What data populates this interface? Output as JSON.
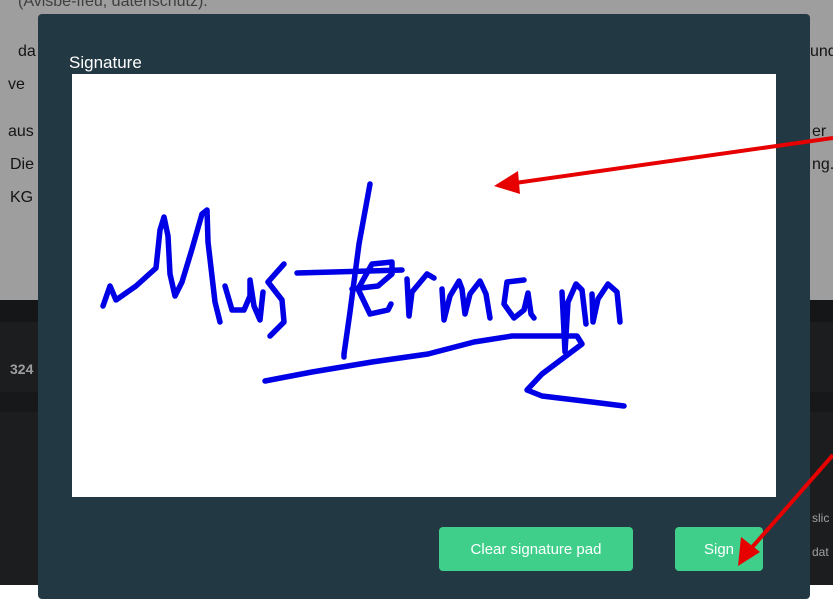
{
  "background": {
    "lines": [
      "(Avisbe-ffeu, datenschutz).",
      "da",
      "ve",
      "aus",
      "Die",
      "KG",
      "und",
      "er",
      "ng.",
      "324",
      "slic",
      "dat"
    ]
  },
  "modal": {
    "title": "Signature",
    "signature_text": "Mustermann"
  },
  "buttons": {
    "clear_label": "Clear signature pad",
    "sign_label": "Sign"
  },
  "colors": {
    "modal_bg": "#223843",
    "button_bg": "#3fcf8a",
    "ink": "#0000e6",
    "annotation_arrow": "#e60000"
  }
}
